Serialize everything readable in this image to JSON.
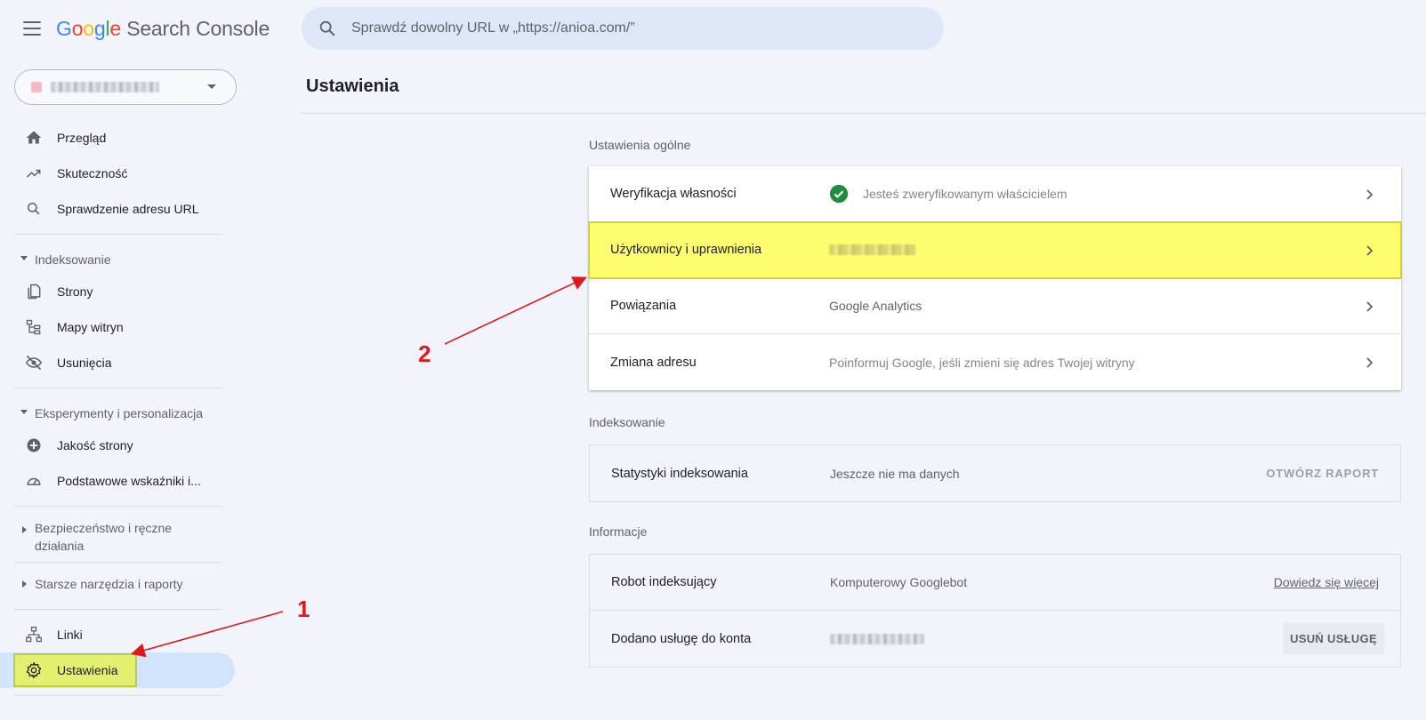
{
  "header": {
    "logo_google": [
      "G",
      "o",
      "o",
      "g",
      "l",
      "e"
    ],
    "logo_product": "Search Console",
    "search_placeholder": "Sprawdź dowolny URL w „https://anioa.com/”"
  },
  "sidebar": {
    "items": [
      {
        "label": "Przegląd",
        "icon": "home-icon"
      },
      {
        "label": "Skuteczność",
        "icon": "trending-up-icon"
      },
      {
        "label": "Sprawdzenie adresu URL",
        "icon": "search-icon"
      }
    ],
    "groups": [
      {
        "label": "Indeksowanie",
        "expanded": true,
        "items": [
          {
            "label": "Strony",
            "icon": "pages-icon"
          },
          {
            "label": "Mapy witryn",
            "icon": "sitemap-icon"
          },
          {
            "label": "Usunięcia",
            "icon": "eye-off-icon"
          }
        ]
      },
      {
        "label": "Eksperymenty i personalizacja",
        "expanded": true,
        "items": [
          {
            "label": "Jakość strony",
            "icon": "plus-circle-icon"
          },
          {
            "label": "Podstawowe wskaźniki i...",
            "icon": "speedometer-icon"
          }
        ]
      },
      {
        "label": "Bezpieczeństwo i ręczne działania",
        "expanded": false
      },
      {
        "label": "Starsze narzędzia i raporty",
        "expanded": false
      }
    ],
    "bottom_items": [
      {
        "label": "Linki",
        "icon": "links-icon"
      },
      {
        "label": "Ustawienia",
        "icon": "gear-icon",
        "active": true
      }
    ]
  },
  "main": {
    "title": "Ustawienia",
    "general": {
      "label": "Ustawienia ogólne",
      "rows": [
        {
          "name": "Weryfikacja własności",
          "value": "Jesteś zweryfikowanym właścicielem"
        },
        {
          "name": "Użytkownicy i uprawnienia",
          "value": ""
        },
        {
          "name": "Powiązania",
          "value": "Google Analytics"
        },
        {
          "name": "Zmiana adresu",
          "value": "Poinformuj Google, jeśli zmieni się adres Twojej witryny"
        }
      ]
    },
    "indexing": {
      "label": "Indeksowanie",
      "row": {
        "name": "Statystyki indeksowania",
        "value": "Jeszcze nie ma danych",
        "action": "OTWÓRZ RAPORT"
      }
    },
    "info": {
      "label": "Informacje",
      "rows": [
        {
          "name": "Robot indeksujący",
          "value": "Komputerowy Googlebot",
          "action": "Dowiedz się więcej"
        },
        {
          "name": "Dodano usługę do konta",
          "value": "",
          "action": "USUŃ USŁUGĘ"
        }
      ]
    }
  },
  "annotations": {
    "one": "1",
    "two": "2"
  },
  "colors": {
    "accent": "#1a73e8",
    "active_nav": "#d2e3fc",
    "highlight": "#fdfd6d",
    "annotation": "#e01818",
    "check": "#1e8e3e"
  }
}
